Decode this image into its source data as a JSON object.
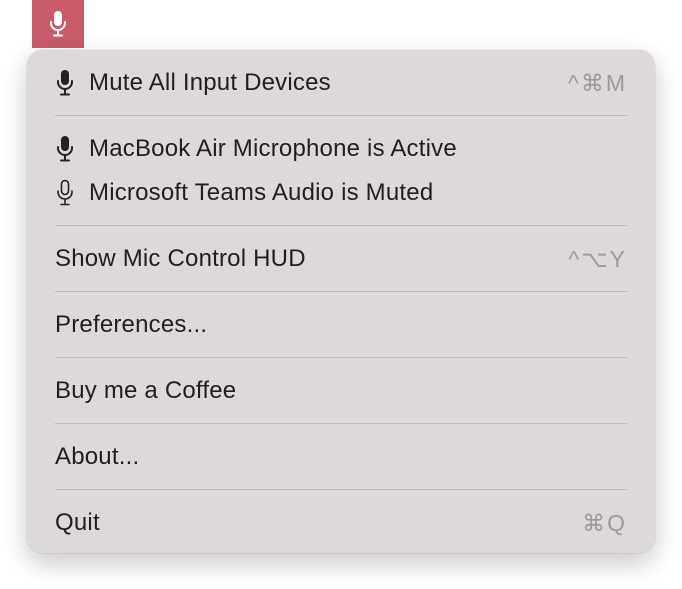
{
  "menubar": {
    "icon": "microphone-icon",
    "accent_color": "#c95b6a"
  },
  "menu": {
    "background_color": "#dcd8dc",
    "items": {
      "mute_all": {
        "label": "Mute All Input Devices",
        "icon": "microphone-filled-icon",
        "shortcut": "^⌘M"
      },
      "device_active": {
        "label": "MacBook Air Microphone is Active",
        "icon": "microphone-filled-icon"
      },
      "device_muted": {
        "label": "Microsoft Teams Audio is Muted",
        "icon": "microphone-outline-icon"
      },
      "show_hud": {
        "label": "Show Mic Control HUD",
        "shortcut": "^⌥Y"
      },
      "preferences": {
        "label": "Preferences..."
      },
      "buy_coffee": {
        "label": "Buy me a Coffee"
      },
      "about": {
        "label": "About..."
      },
      "quit": {
        "label": "Quit",
        "shortcut": "⌘Q"
      }
    }
  }
}
